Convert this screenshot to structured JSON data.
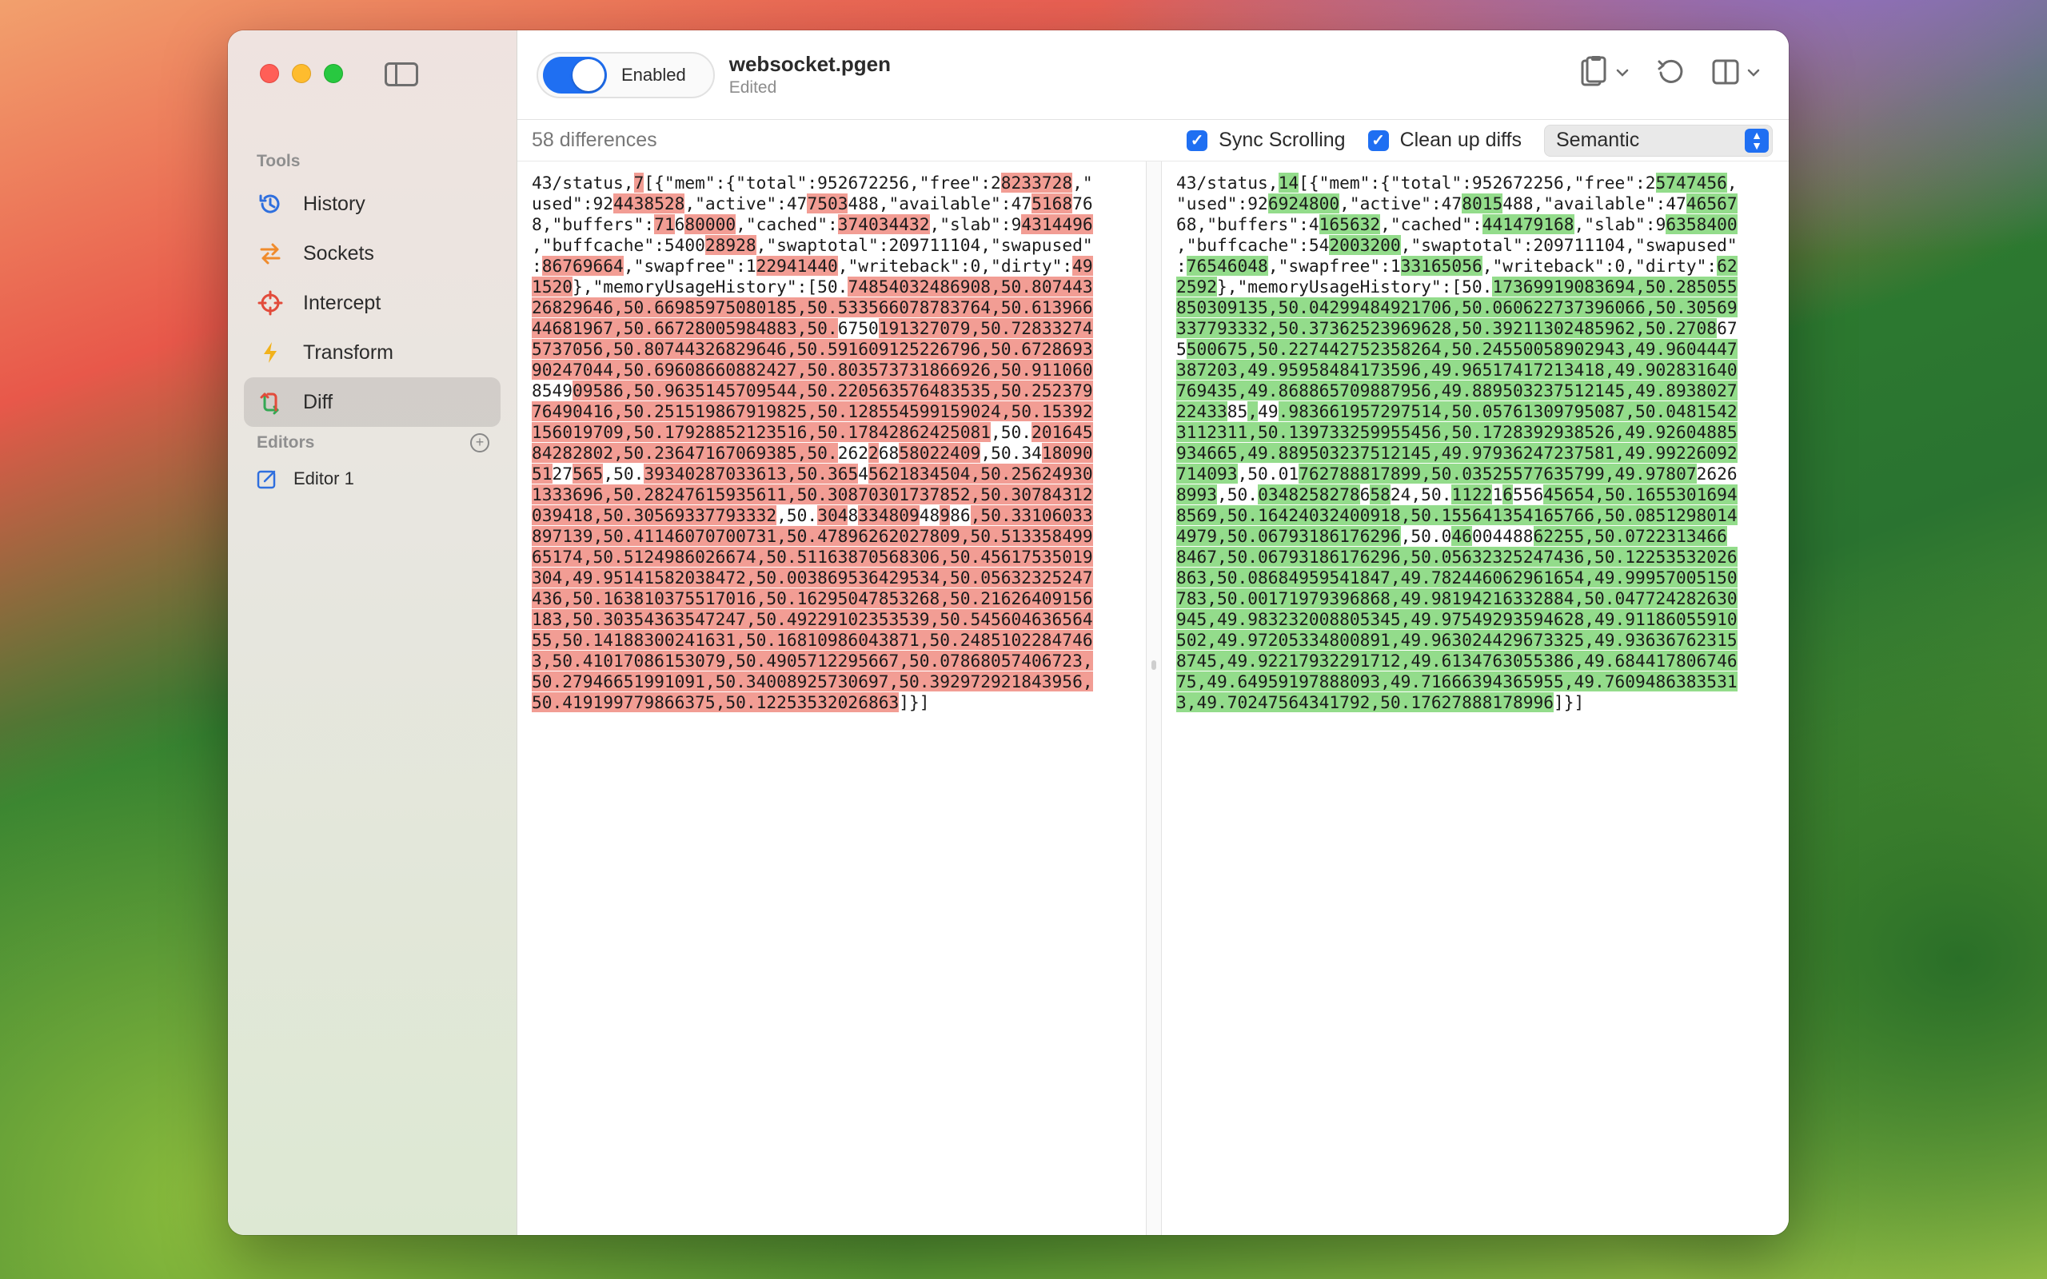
{
  "app": {
    "toggle_label": "Enabled",
    "document_name": "websocket.pgen",
    "document_status": "Edited"
  },
  "sidebar": {
    "tools_header": "Tools",
    "items": [
      {
        "label": "History",
        "icon": "history-icon",
        "color": "#2f6fde"
      },
      {
        "label": "Sockets",
        "icon": "sockets-icon",
        "color": "#f08b2c"
      },
      {
        "label": "Intercept",
        "icon": "intercept-icon",
        "color": "#e24b3b"
      },
      {
        "label": "Transform",
        "icon": "transform-icon",
        "color": "#f2b21b"
      },
      {
        "label": "Diff",
        "icon": "diff-icon",
        "color": "#34a853"
      }
    ],
    "active_item": "Diff",
    "editors_header": "Editors",
    "editors": [
      {
        "label": "Editor 1",
        "icon": "editor-icon"
      }
    ]
  },
  "infobar": {
    "diff_count": "58 differences",
    "sync_scrolling_label": "Sync Scrolling",
    "sync_scrolling_checked": true,
    "cleanup_label": "Clean up diffs",
    "cleanup_checked": true,
    "mode_value": "Semantic"
  },
  "diff": {
    "left": [
      [
        [
          "43/status,",
          0
        ],
        [
          "7",
          1
        ],
        [
          "[{\"mem\":{\"total\":952672256,\"free\":2",
          0
        ],
        [
          "8233728",
          1
        ],
        [
          ",\"",
          0
        ]
      ],
      [
        [
          "used\":92",
          0
        ],
        [
          "4438528",
          1
        ],
        [
          ",\"active\":47",
          0
        ],
        [
          "7503",
          1
        ],
        [
          "488,\"available\":47",
          0
        ],
        [
          "5168",
          1
        ],
        [
          "76",
          0
        ]
      ],
      [
        [
          "8,\"buffers\":",
          0
        ],
        [
          "71",
          1
        ],
        [
          "6",
          0
        ],
        [
          "80000",
          1
        ],
        [
          ",\"cached\":",
          0
        ],
        [
          "374034432",
          1
        ],
        [
          ",\"slab\":9",
          0
        ],
        [
          "4314496",
          1
        ]
      ],
      [
        [
          ",\"buffcache\":5400",
          0
        ],
        [
          "28928",
          1
        ],
        [
          ",\"swaptotal\":209711104,\"swapused\"",
          0
        ]
      ],
      [
        [
          ":",
          0
        ],
        [
          "86769664",
          1
        ],
        [
          ",\"swapfree\":1",
          0
        ],
        [
          "22941440",
          1
        ],
        [
          ",\"writeback\":0,\"dirty\":",
          0
        ],
        [
          "49",
          1
        ]
      ],
      [
        [
          "1520",
          1
        ],
        [
          "},\"memoryUsageHistory\":[50.",
          0
        ],
        [
          "74854032486908,50.807443",
          1
        ]
      ],
      [
        [
          "26829646,50.66985975080185,50.533566078783764,50.613966",
          1
        ]
      ],
      [
        [
          "44681967,50.66728005984883,50.",
          1
        ],
        [
          "6750",
          0
        ],
        [
          "191327079,50.72833274",
          1
        ]
      ],
      [
        [
          "5737056,50.80744326829646,50.591609125226796,50.6728693",
          1
        ]
      ],
      [
        [
          "90247044,50.69608660882427,50.803573731866926,50.911060",
          1
        ]
      ],
      [
        [
          "8549",
          0
        ],
        [
          "09586,50.9635145709544,50.220563576483535,50.252379",
          1
        ]
      ],
      [
        [
          "76490416,50.251519867919825,50.128554599159024,50.15392",
          1
        ]
      ],
      [
        [
          "156019709,50.17928852123516,50.17842862425081",
          1
        ],
        [
          ",50.",
          0
        ],
        [
          "201645",
          1
        ]
      ],
      [
        [
          "84282802,50.23647167069385,50.",
          1
        ],
        [
          "262",
          0
        ],
        [
          "2",
          1
        ],
        [
          "68",
          0
        ],
        [
          "58022409",
          1
        ],
        [
          ",50.34",
          0
        ],
        [
          "18090",
          1
        ]
      ],
      [
        [
          "51",
          1
        ],
        [
          "27",
          0
        ],
        [
          "565",
          1
        ],
        [
          ",50.",
          0
        ],
        [
          "39340287033613,50.365",
          1
        ],
        [
          "4",
          0
        ],
        [
          "5621834504,50.25624930",
          1
        ]
      ],
      [
        [
          "1333696,50.28247615935611,50.30870301737852,50.30784312",
          1
        ]
      ],
      [
        [
          "039418,50.30569337793332",
          1
        ],
        [
          ",50.",
          0
        ],
        [
          "304",
          1
        ],
        [
          "8",
          0
        ],
        [
          "334809",
          1
        ],
        [
          "48",
          0
        ],
        [
          "9",
          1
        ],
        [
          "86",
          0
        ],
        [
          ",50.33106033",
          1
        ]
      ],
      [
        [
          "897139,50.41146070700731,50.47896262027809,50.513358499",
          1
        ]
      ],
      [
        [
          "65174,50.5124986026674,50.51163870568306,50.45617535019",
          1
        ]
      ],
      [
        [
          "304,49.95141582038472,50.003869536429534,50.05632325247",
          1
        ]
      ],
      [
        [
          "436,50.163810375517016,50.16295047853268,50.21626409156",
          1
        ]
      ],
      [
        [
          "183,50.30354363547247,50.49229102353539,50.545604636564",
          1
        ]
      ],
      [
        [
          "55,50.14188300241631,50.16810986043871,50.2485102284746",
          1
        ]
      ],
      [
        [
          "3,50.41017086153079,50.4905712295667,50.07868057406723,",
          1
        ]
      ],
      [
        [
          "50.27946651991091,50.34008925730697,50.392972921843956,",
          1
        ]
      ],
      [
        [
          "50.419199779866375,50.12253532026863",
          1
        ],
        [
          "]}]",
          0
        ]
      ]
    ],
    "right": [
      [
        [
          "43/status,",
          0
        ],
        [
          "14",
          1
        ],
        [
          "[{\"mem\":{\"total\":952672256,\"free\":2",
          0
        ],
        [
          "5747456",
          1
        ],
        [
          ",",
          0
        ]
      ],
      [
        [
          "\"used\":92",
          0
        ],
        [
          "6924800",
          1
        ],
        [
          ",\"active\":47",
          0
        ],
        [
          "8015",
          1
        ],
        [
          "488,\"available\":47",
          0
        ],
        [
          "46567",
          1
        ]
      ],
      [
        [
          "68,\"buffers\":4",
          0
        ],
        [
          "165632",
          1
        ],
        [
          ",\"cached\":",
          0
        ],
        [
          "441479168",
          1
        ],
        [
          ",\"slab\":9",
          0
        ],
        [
          "6358400",
          1
        ]
      ],
      [
        [
          ",\"buffcache\":54",
          0
        ],
        [
          "2003200",
          1
        ],
        [
          ",\"swaptotal\":209711104,\"swapused\"",
          0
        ]
      ],
      [
        [
          ":",
          0
        ],
        [
          "76546048",
          1
        ],
        [
          ",\"swapfree\":1",
          0
        ],
        [
          "33165056",
          1
        ],
        [
          ",\"writeback\":0,\"dirty\":",
          0
        ],
        [
          "62",
          1
        ]
      ],
      [
        [
          "2592",
          1
        ],
        [
          "},\"memoryUsageHistory\":[50.",
          0
        ],
        [
          "17369919083694,50.285055",
          1
        ]
      ],
      [
        [
          "850309135,50.04299484921706,50.060622737396066,50.30569",
          1
        ]
      ],
      [
        [
          "337793332,50.37362523969628,50.39211302485962,50.2708",
          1
        ],
        [
          "67",
          0
        ]
      ],
      [
        [
          "5",
          0
        ],
        [
          "5",
          1
        ],
        [
          "00675,50.227442752358264,50.24550058902943,49.9604447",
          1
        ]
      ],
      [
        [
          "387203,49.95958484173596,49.96517417213418,49.902831640",
          1
        ]
      ],
      [
        [
          "769435,49.868865709887956,49.889503237512145,49.8938027",
          1
        ]
      ],
      [
        [
          "22433",
          1
        ],
        [
          "85",
          0
        ],
        [
          ",",
          1
        ],
        [
          "49",
          0
        ],
        [
          ".983661957297514,50.05761309795087,50.0481542",
          1
        ]
      ],
      [
        [
          "3112311,50.139733259955456,50.1728392938526,49.92604885",
          1
        ]
      ],
      [
        [
          "934665,49.889503237512145,49.97936247237581,49.99226092",
          1
        ]
      ],
      [
        [
          "714093",
          1
        ],
        [
          ",50.01",
          0
        ],
        [
          "762788817899,50.03525577635799,49.97807",
          1
        ],
        [
          "2626",
          0
        ]
      ],
      [
        [
          "8993",
          1
        ],
        [
          ",50.",
          0
        ],
        [
          "0348258278",
          1
        ],
        [
          "6",
          0
        ],
        [
          "58",
          1
        ],
        [
          "24",
          0
        ],
        [
          ",50.",
          0
        ],
        [
          "1122",
          1
        ],
        [
          "1",
          0
        ],
        [
          "6",
          1
        ],
        [
          "556",
          0
        ],
        [
          "45654,50.1655301694",
          1
        ]
      ],
      [
        [
          "8569,50.16424032400918,50.155641354165766,50.0851298014",
          1
        ]
      ],
      [
        [
          "4979,50.06793186176296",
          1
        ],
        [
          ",50.0",
          0
        ],
        [
          "46",
          1
        ],
        [
          "004",
          0
        ],
        [
          "488",
          0
        ],
        [
          "62255,50.0722313466",
          1
        ]
      ],
      [
        [
          "8467,50.06793186176296,50.05632325247436,50.12253532026",
          1
        ]
      ],
      [
        [
          "863,50.08684959541847,49.782446062961654,49.99957005150",
          1
        ]
      ],
      [
        [
          "783,50.00171979396868,49.98194216332884,50.047724282630",
          1
        ]
      ],
      [
        [
          "945,49.983232008805345,49.97549293594628,49.91186055910",
          1
        ]
      ],
      [
        [
          "502,49.97205334800891,49.963024429673325,49.93636762315",
          1
        ]
      ],
      [
        [
          "8745,49.92217932291712,49.6134763055386,49.684417806746",
          1
        ]
      ],
      [
        [
          "75,49.64959197888093,49.71666394365955,49.7609486383531",
          1
        ]
      ],
      [
        [
          "3,49.70247564341792,50.17627888178996",
          1
        ],
        [
          "]}]",
          0
        ]
      ]
    ]
  }
}
